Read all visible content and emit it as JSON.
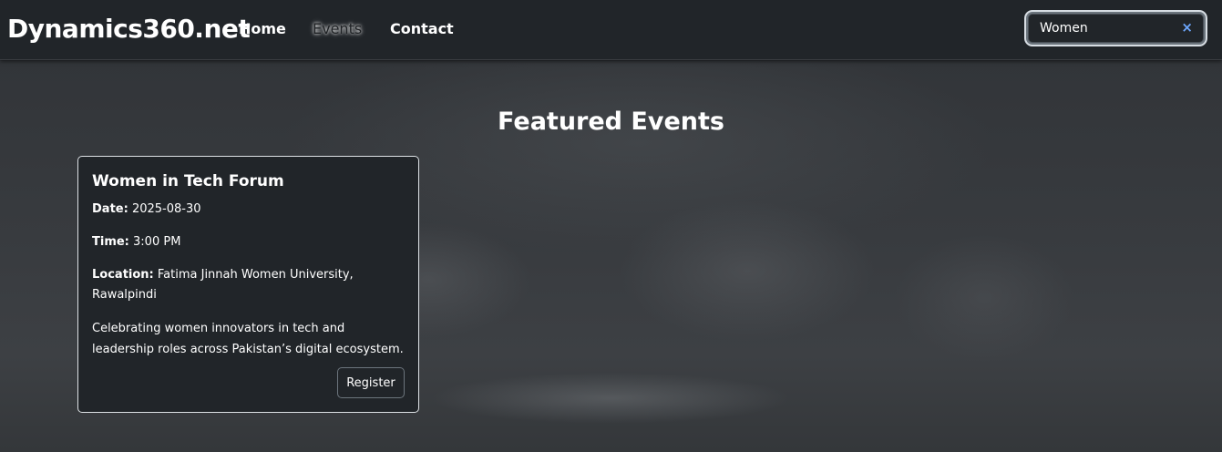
{
  "navbar": {
    "brand": "Dynamics360.net",
    "links": [
      "Home",
      "Events",
      "Contact"
    ],
    "active_link": "Events"
  },
  "search": {
    "value": "Women",
    "clear_icon": "×"
  },
  "hero": {
    "title": "Featured Events"
  },
  "events": [
    {
      "title": "Women in Tech Forum",
      "date_label": "Date:",
      "date": "2025-08-30",
      "time_label": "Time:",
      "time": "3:00 PM",
      "location_label": "Location:",
      "location": "Fatima Jinnah Women University, Rawalpindi",
      "description": "Celebrating women innovators in tech and leadership roles across Pakistan’s digital ecosystem.",
      "button_label": "Register"
    }
  ]
}
